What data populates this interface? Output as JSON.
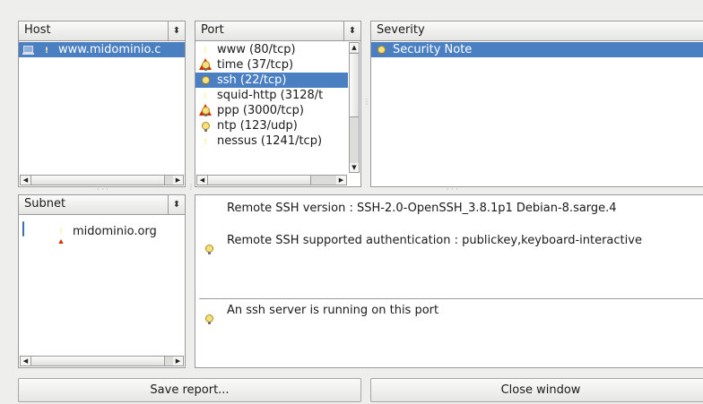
{
  "host_panel": {
    "header": "Host",
    "items": [
      {
        "label": "www.midominio.c"
      }
    ]
  },
  "port_panel": {
    "header": "Port",
    "items": [
      {
        "label": "www (80/tcp)",
        "icon": "warning-icon"
      },
      {
        "label": "time (37/tcp)",
        "icon": "note-icon"
      },
      {
        "label": "ssh (22/tcp)",
        "icon": "note-icon",
        "selected": true
      },
      {
        "label": "squid-http (3128/t",
        "icon": "warning-icon"
      },
      {
        "label": "ppp (3000/tcp)",
        "icon": "note-icon"
      },
      {
        "label": "ntp (123/udp)",
        "icon": "note-icon"
      },
      {
        "label": "nessus (1241/tcp)",
        "icon": "warning-icon"
      }
    ]
  },
  "severity_panel": {
    "header": "Severity",
    "items": [
      {
        "label": "Security Note",
        "icon": "note-icon",
        "selected": true
      }
    ]
  },
  "subnet_panel": {
    "header": "Subnet",
    "items": [
      {
        "label": "midominio.org"
      }
    ]
  },
  "report": {
    "lines": [
      "Remote SSH version : SSH-2.0-OpenSSH_3.8.1p1 Debian-8.sarge.4",
      "Remote SSH supported authentication : publickey,keyboard-interactive",
      "An ssh server is running on this port"
    ]
  },
  "buttons": {
    "save": "Save report...",
    "close": "Close window"
  },
  "colors": {
    "selection": "#4a7fc1",
    "warning": "#d22f00",
    "window_bg": "#eeeeec"
  }
}
